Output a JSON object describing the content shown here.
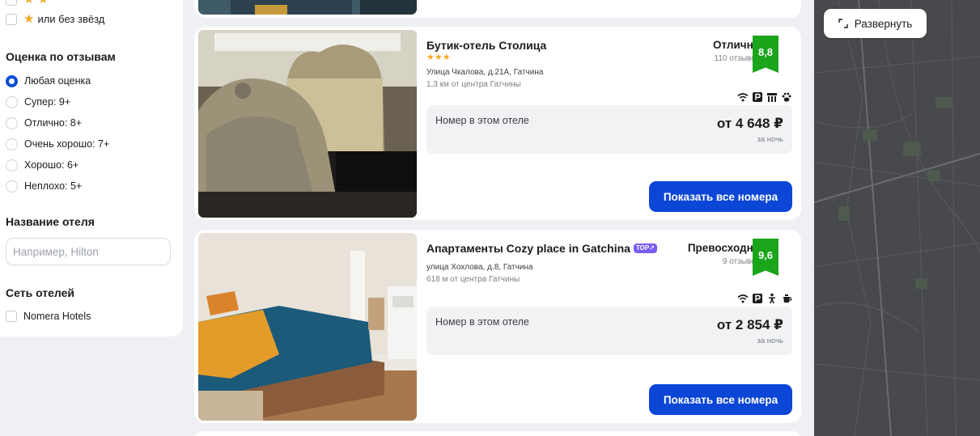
{
  "filters": {
    "stars_row_label": "или без звёзд",
    "rating_title": "Оценка по отзывам",
    "rating_options": [
      {
        "label": "Любая оценка",
        "selected": true
      },
      {
        "label": "Супер: 9+",
        "selected": false
      },
      {
        "label": "Отлично: 8+",
        "selected": false
      },
      {
        "label": "Очень хорошо: 7+",
        "selected": false
      },
      {
        "label": "Хорошо: 6+",
        "selected": false
      },
      {
        "label": "Неплохо: 5+",
        "selected": false
      }
    ],
    "name_title": "Название отеля",
    "name_placeholder": "Например, Hilton",
    "chain_title": "Сеть отелей",
    "chain_options": [
      {
        "label": "Nomera Hotels"
      }
    ]
  },
  "hotels": [
    {
      "name": "Бутик-отель Столица",
      "stars": "★★★",
      "address": "Улица Чкалова, д.21А, Гатчина",
      "distance": "1,3 км от центра Гатчины",
      "rating_word": "Отлично",
      "reviews": "110 отзывов",
      "score": "8,8",
      "amenities": [
        "wifi-icon",
        "parking-icon",
        "restaurant-icon",
        "pets-icon"
      ],
      "room_label": "Номер в этом отеле",
      "price": "от 4 648 ₽",
      "per_night": "за ночь",
      "button": "Показать все номера"
    },
    {
      "name": "Апартаменты Cozy place in Gatchina",
      "badge": "TOP↗",
      "address": "улица Хохлова, д.8, Гатчина",
      "distance": "618 м от центра Гатчины",
      "rating_word": "Превосходно",
      "reviews": "9 отзывов",
      "score": "9,6",
      "amenities": [
        "wifi-icon",
        "parking-icon",
        "child-icon",
        "kettle-icon"
      ],
      "room_label": "Номер в этом отеле",
      "price": "от 2 854 ₽",
      "per_night": "за ночь",
      "button": "Показать все номера"
    }
  ],
  "map": {
    "expand_label": "Развернуть"
  },
  "colors": {
    "primary": "#0b46d6",
    "score": "#1aa51b",
    "star": "#f5a623",
    "map_bg": "#47494c"
  }
}
